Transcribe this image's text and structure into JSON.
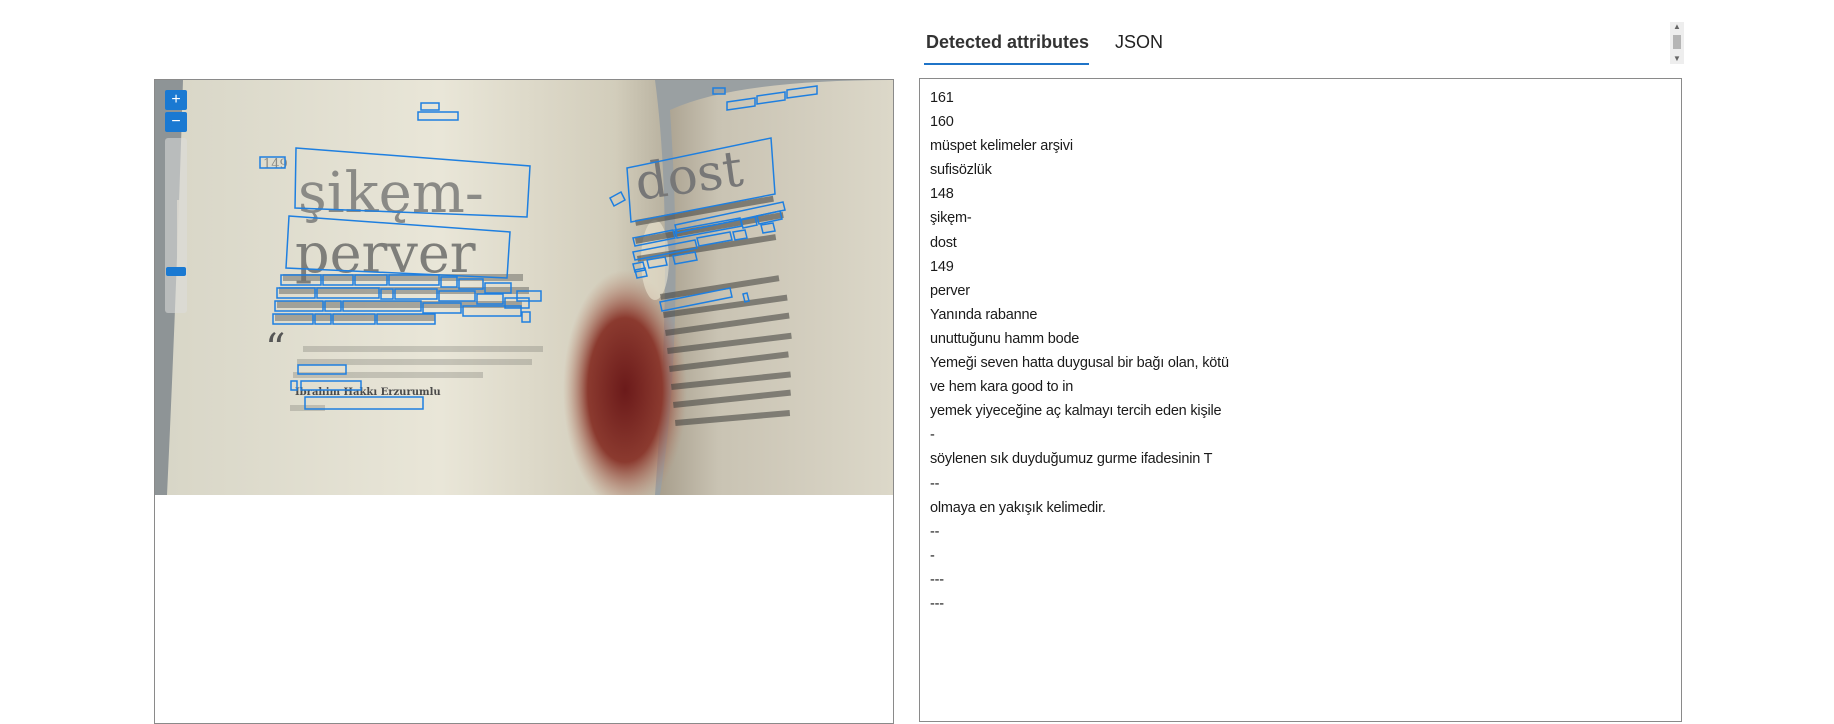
{
  "tabs": [
    {
      "label": "Detected attributes",
      "active": true
    },
    {
      "label": "JSON",
      "active": false
    }
  ],
  "viewer": {
    "zoom_in_label": "+",
    "zoom_out_label": "−",
    "zoom_level": 0.22
  },
  "photo": {
    "page_numbers": [
      "149"
    ],
    "headwords": [
      "şikęm-",
      "perver",
      "dost"
    ],
    "quote_author": "Ibrahim Hakkı Erzurumlu"
  },
  "detected_lines": [
    "161",
    "160",
    "müspet kelimeler arşivi",
    "sufisözlük",
    "148",
    "şikęm-",
    "dost",
    "149",
    "perver",
    "Yanında rabanne",
    "unuttuğunu hamm bode",
    "Yemeği seven hatta duygusal bir bağı olan, kötü",
    "ve hem kara good to in",
    "yemek yiyeceğine aç kalmayı tercih eden kişile",
    "-",
    "söylenen sık duyduğumuz gurme ifadesinin T",
    "--",
    "olmaya en yakışık kelimedir.",
    "--",
    "-",
    "---",
    "---"
  ],
  "colors": {
    "accent": "#1a79d2",
    "box_stroke": "#1e7fe0",
    "border": "#8a8a8a"
  },
  "icons": {
    "scroll_up": "triangle-up-icon",
    "scroll_down": "triangle-down-icon"
  }
}
